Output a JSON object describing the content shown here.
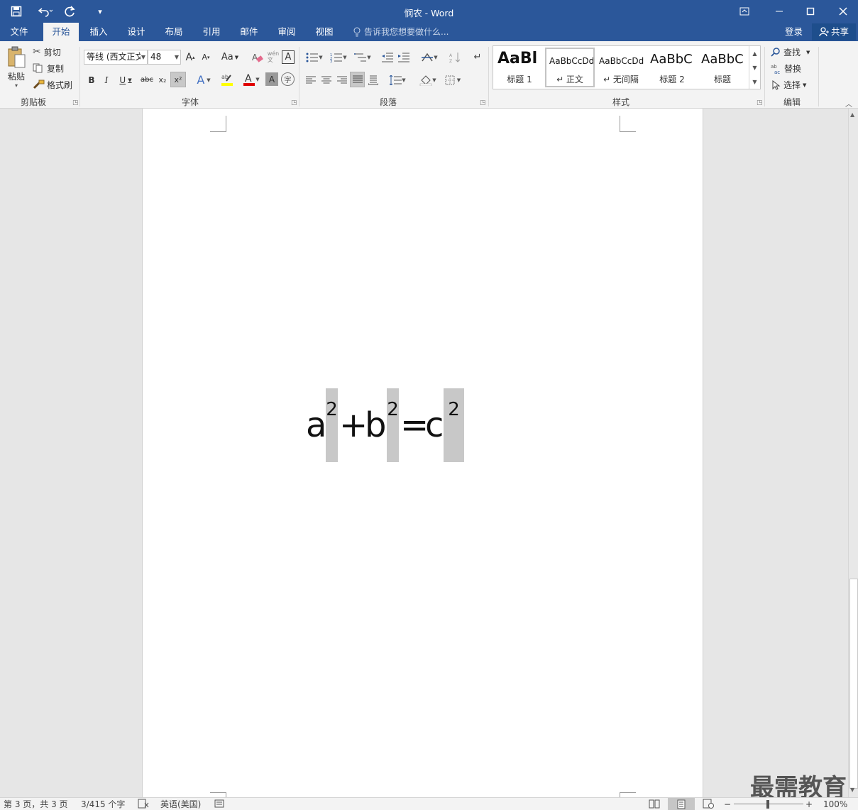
{
  "window": {
    "title": "悯农 - Word",
    "qat": {
      "save_icon": "save-icon",
      "undo_icon": "undo-icon",
      "redo_icon": "redo-icon",
      "customize_icon": "customize-qat-icon"
    }
  },
  "tabs": [
    "文件",
    "开始",
    "插入",
    "设计",
    "布局",
    "引用",
    "邮件",
    "审阅",
    "视图"
  ],
  "active_tab": "开始",
  "tell_me": "告诉我您想要做什么...",
  "account": {
    "login": "登录",
    "share": "共享"
  },
  "clipboard": {
    "paste": "粘贴",
    "cut": "剪切",
    "copy": "复制",
    "format_painter": "格式刷",
    "label": "剪贴板"
  },
  "font": {
    "name": "等线 (西文正文",
    "size": "48",
    "grow": "A",
    "shrink": "A",
    "case": "Aa",
    "bold": "B",
    "italic": "I",
    "underline": "U",
    "strike": "abc",
    "subscript": "x₂",
    "superscript": "x²",
    "label": "字体"
  },
  "paragraph": {
    "label": "段落"
  },
  "styles": {
    "items": [
      {
        "preview": "AaBl",
        "name": "标题 1"
      },
      {
        "preview": "AaBbCcDd",
        "name": "↵ 正文"
      },
      {
        "preview": "AaBbCcDd",
        "name": "↵ 无间隔"
      },
      {
        "preview": "AaBbC",
        "name": "标题 2"
      },
      {
        "preview": "AaBbC",
        "name": "标题"
      }
    ],
    "label": "样式"
  },
  "editing": {
    "find": "查找",
    "replace": "替换",
    "select": "选择",
    "label": "编辑"
  },
  "document": {
    "formula": {
      "a": "a",
      "sa": "2",
      "plus": "+",
      "b": "b",
      "sb": "2",
      "eq": "=",
      "c": "c",
      "sc": "2"
    }
  },
  "status": {
    "page": "第 3 页，共 3 页",
    "words": "3/415 个字",
    "language": "英语(美国)",
    "zoom": "100%"
  },
  "watermark": "最需教育",
  "colors": {
    "accent": "#2b579a",
    "highlight": "#ffff00",
    "font_color": "#e00000",
    "selection": "#c8c8c8"
  }
}
